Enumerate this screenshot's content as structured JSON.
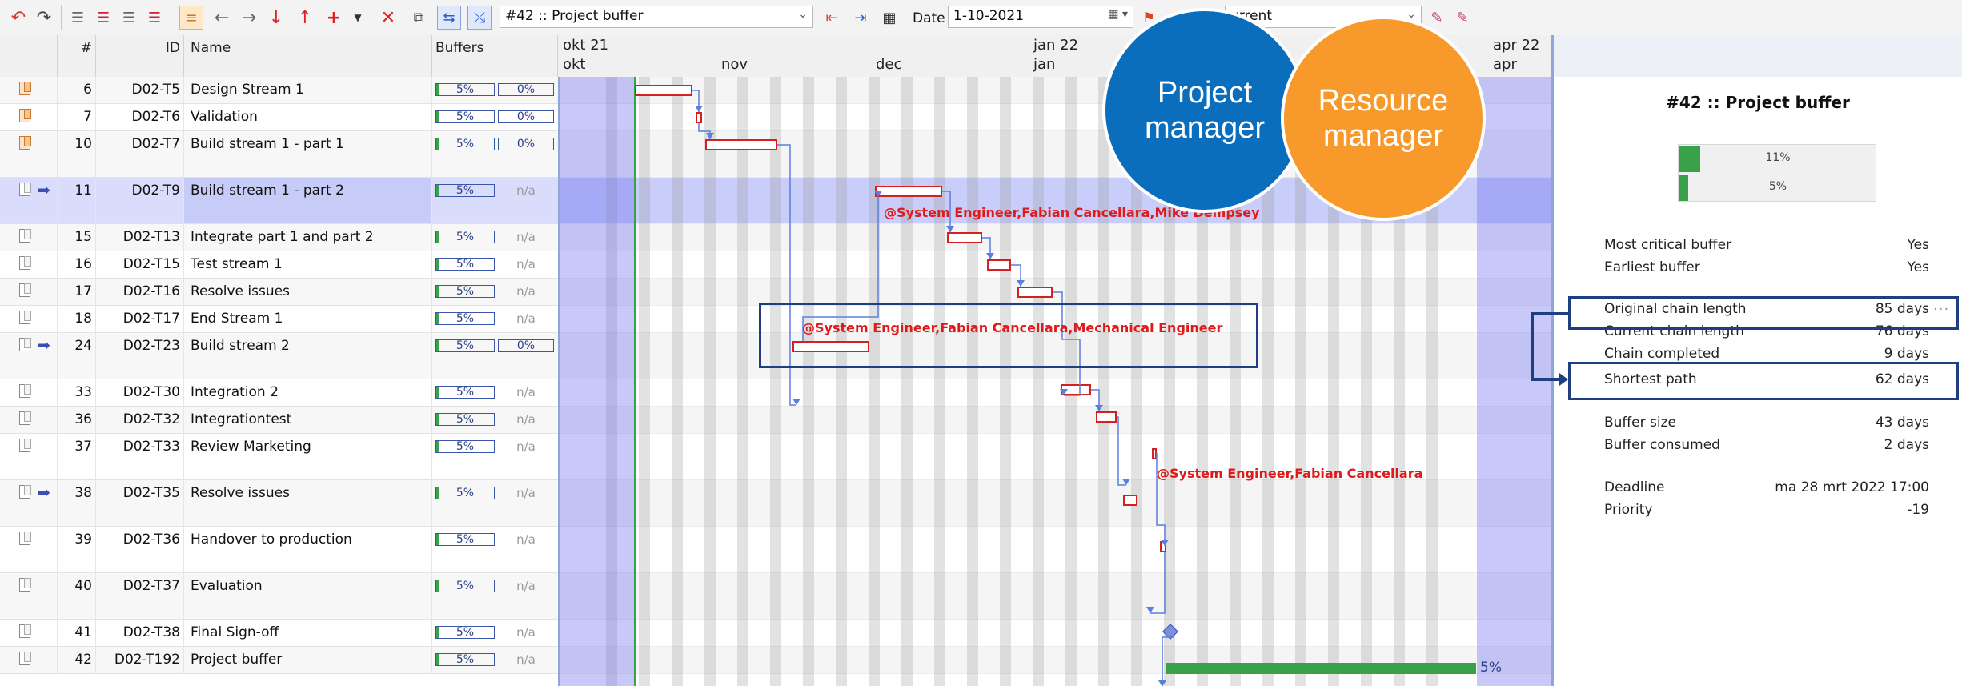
{
  "toolbar": {
    "buffer_select": "#42 :: Project buffer",
    "date_label": "Date",
    "date_value": "1-10-2021",
    "view_select_partial": "urrent"
  },
  "columns": {
    "num": "#",
    "id": "ID",
    "name": "Name",
    "buffers": "Buffers"
  },
  "rows": [
    {
      "num": "6",
      "id": "D02-T5",
      "name": "Design Stream 1",
      "b1": "5%",
      "b2": "0%",
      "icon": "orange"
    },
    {
      "num": "7",
      "id": "D02-T6",
      "name": "Validation",
      "b1": "5%",
      "b2": "0%",
      "icon": "orange"
    },
    {
      "num": "10",
      "id": "D02-T7",
      "name": "Build stream 1 - part 1",
      "b1": "5%",
      "b2": "0%",
      "icon": "orange"
    },
    {
      "num": "11",
      "id": "D02-T9",
      "name": "Build stream 1 - part 2",
      "b1": "5%",
      "b2": "n/a",
      "icon": "gray",
      "arrow": true,
      "selected": true
    },
    {
      "num": "15",
      "id": "D02-T13",
      "name": "Integrate part 1 and part 2",
      "b1": "5%",
      "b2": "n/a",
      "icon": "gray"
    },
    {
      "num": "16",
      "id": "D02-T15",
      "name": "Test stream 1",
      "b1": "5%",
      "b2": "n/a",
      "icon": "gray"
    },
    {
      "num": "17",
      "id": "D02-T16",
      "name": "Resolve issues",
      "b1": "5%",
      "b2": "n/a",
      "icon": "gray"
    },
    {
      "num": "18",
      "id": "D02-T17",
      "name": "End Stream 1",
      "b1": "5%",
      "b2": "n/a",
      "icon": "gray"
    },
    {
      "num": "24",
      "id": "D02-T23",
      "name": "Build stream 2",
      "b1": "5%",
      "b2": "0%",
      "icon": "gray",
      "arrow": true
    },
    {
      "num": "33",
      "id": "D02-T30",
      "name": "Integration 2",
      "b1": "5%",
      "b2": "n/a",
      "icon": "gray"
    },
    {
      "num": "36",
      "id": "D02-T32",
      "name": "Integrationtest",
      "b1": "5%",
      "b2": "n/a",
      "icon": "gray"
    },
    {
      "num": "37",
      "id": "D02-T33",
      "name": "Review Marketing",
      "b1": "5%",
      "b2": "n/a",
      "icon": "gray"
    },
    {
      "num": "38",
      "id": "D02-T35",
      "name": "Resolve issues",
      "b1": "5%",
      "b2": "n/a",
      "icon": "gray",
      "arrow": true
    },
    {
      "num": "39",
      "id": "D02-T36",
      "name": "Handover to production",
      "b1": "5%",
      "b2": "n/a",
      "icon": "gray"
    },
    {
      "num": "40",
      "id": "D02-T37",
      "name": "Evaluation",
      "b1": "5%",
      "b2": "n/a",
      "icon": "gray"
    },
    {
      "num": "41",
      "id": "D02-T38",
      "name": "Final Sign-off",
      "b1": "5%",
      "b2": "n/a",
      "icon": "gray"
    },
    {
      "num": "42",
      "id": "D02-T192",
      "name": "Project buffer",
      "b1": "5%",
      "b2": "n/a",
      "icon": "gray"
    }
  ],
  "gantt": {
    "top_months": [
      "okt 21",
      "jan 22",
      "apr 22"
    ],
    "bottom_months": [
      "okt",
      "nov",
      "dec",
      "jan",
      "apr"
    ],
    "resource_labels": [
      "@System  Engineer,Fabian  Cancellara,Mike  Dempsey",
      "@System  Engineer,Fabian  Cancellara,Mechanical  Engineer",
      "@System  Engineer,Fabian  Cancellara"
    ],
    "buffer_percent": "5%"
  },
  "panel": {
    "title": "#42 :: Project buffer",
    "gauge_top": "11%",
    "gauge_bottom": "5%",
    "gauge_top_fraction": 0.11,
    "gauge_bottom_fraction": 0.05,
    "fields": [
      {
        "label": "Most critical buffer",
        "value": "Yes"
      },
      {
        "label": "Earliest buffer",
        "value": "Yes"
      },
      {
        "label": "Original chain length",
        "value": "85 days"
      },
      {
        "label": "Current chain length",
        "value": "76 days"
      },
      {
        "label": "Chain completed",
        "value": "9 days"
      },
      {
        "label": "Shortest path",
        "value": "62 days"
      },
      {
        "label": "Buffer size",
        "value": "43 days"
      },
      {
        "label": "Buffer consumed",
        "value": "2 days"
      },
      {
        "label": "Deadline",
        "value": "ma 28 mrt 2022 17:00"
      },
      {
        "label": "Priority",
        "value": "-19"
      }
    ]
  },
  "overlay": {
    "project_manager": "Project manager",
    "resource_manager": "Resource manager",
    "project_manager_color": "#0a6ebd",
    "resource_manager_color": "#f7992b"
  }
}
